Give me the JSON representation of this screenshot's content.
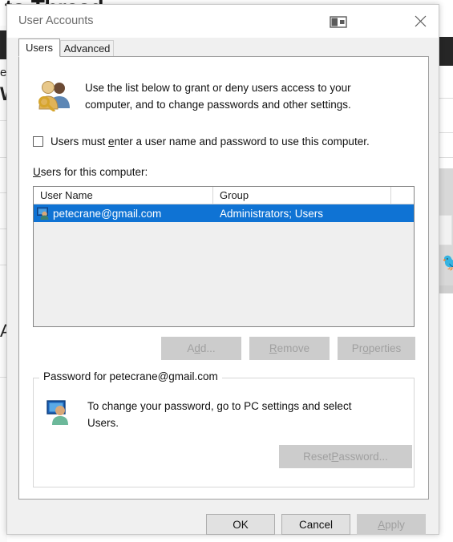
{
  "background": {
    "heading": "to Thread",
    "fragment_left": "e",
    "letter_a": "A",
    "letter_w": "W"
  },
  "dialog": {
    "title": "User Accounts",
    "help_icon": "window-help-icon",
    "close_icon": "close-icon",
    "tabs": [
      {
        "label": "Users",
        "active": true
      },
      {
        "label": "Advanced",
        "active": false
      }
    ],
    "info": {
      "icon": "users-with-key-icon",
      "line1": "Use the list below to grant or deny users access to your",
      "line2": "computer, and to change passwords and other settings."
    },
    "require_password_checkbox": {
      "label_before": "Users must ",
      "accel": "e",
      "label_after": "nter a user name and password to use this computer.",
      "checked": false
    },
    "list_label_accel": "U",
    "list_label_rest": "sers for this computer:",
    "list": {
      "columns": [
        "User Name",
        "Group",
        ""
      ],
      "rows": [
        {
          "icon": "user-account-icon",
          "user_name": "petecrane@gmail.com",
          "group": "Administrators; Users",
          "selected": true
        }
      ]
    },
    "list_buttons": [
      {
        "name": "add-button",
        "pre": "A",
        "accel": "d",
        "post": "d...",
        "enabled": false
      },
      {
        "name": "remove-button",
        "pre": "",
        "accel": "R",
        "post": "emove",
        "enabled": false
      },
      {
        "name": "properties-button",
        "pre": "Pr",
        "accel": "o",
        "post": "perties",
        "enabled": false
      }
    ],
    "password_group": {
      "legend": "Password for petecrane@gmail.com",
      "icon": "user-account-large-icon",
      "line1": "To change your password, go to PC settings and select",
      "line2": "Users.",
      "reset_button": {
        "pre": "Reset ",
        "accel": "P",
        "post": "assword...",
        "enabled": false
      }
    },
    "footer_buttons": [
      {
        "name": "ok-button",
        "label": "OK",
        "enabled": true
      },
      {
        "name": "cancel-button",
        "label": "Cancel",
        "enabled": true
      },
      {
        "name": "apply-button",
        "pre": "",
        "accel": "A",
        "post": "pply",
        "enabled": false
      }
    ]
  },
  "colors": {
    "selection_blue": "#0f73d4",
    "dialog_bg": "#f0f0f0",
    "panel_bg": "#ffffff",
    "disabled_text": "#a0a0a0",
    "title_text": "#6b6b6b"
  }
}
